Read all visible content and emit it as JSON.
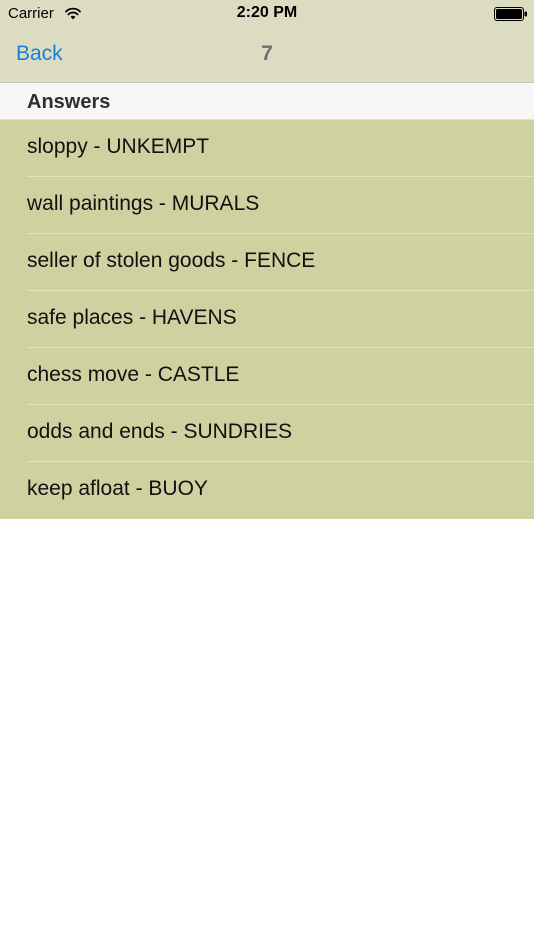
{
  "status_bar": {
    "carrier": "Carrier",
    "time": "2:20 PM"
  },
  "nav": {
    "back_label": "Back",
    "title": "7"
  },
  "section": {
    "header": "Answers"
  },
  "answers": [
    "sloppy - UNKEMPT",
    "wall paintings - MURALS",
    "seller of stolen goods - FENCE",
    "safe places - HAVENS",
    "chess move - CASTLE",
    "odds and ends - SUNDRIES",
    "keep afloat - BUOY"
  ],
  "colors": {
    "nav_background": "#dcdcc2",
    "row_background": "#cfd1a1",
    "link": "#1a7fd9"
  },
  "icons": {
    "wifi": "wifi-icon",
    "battery": "battery-icon"
  }
}
